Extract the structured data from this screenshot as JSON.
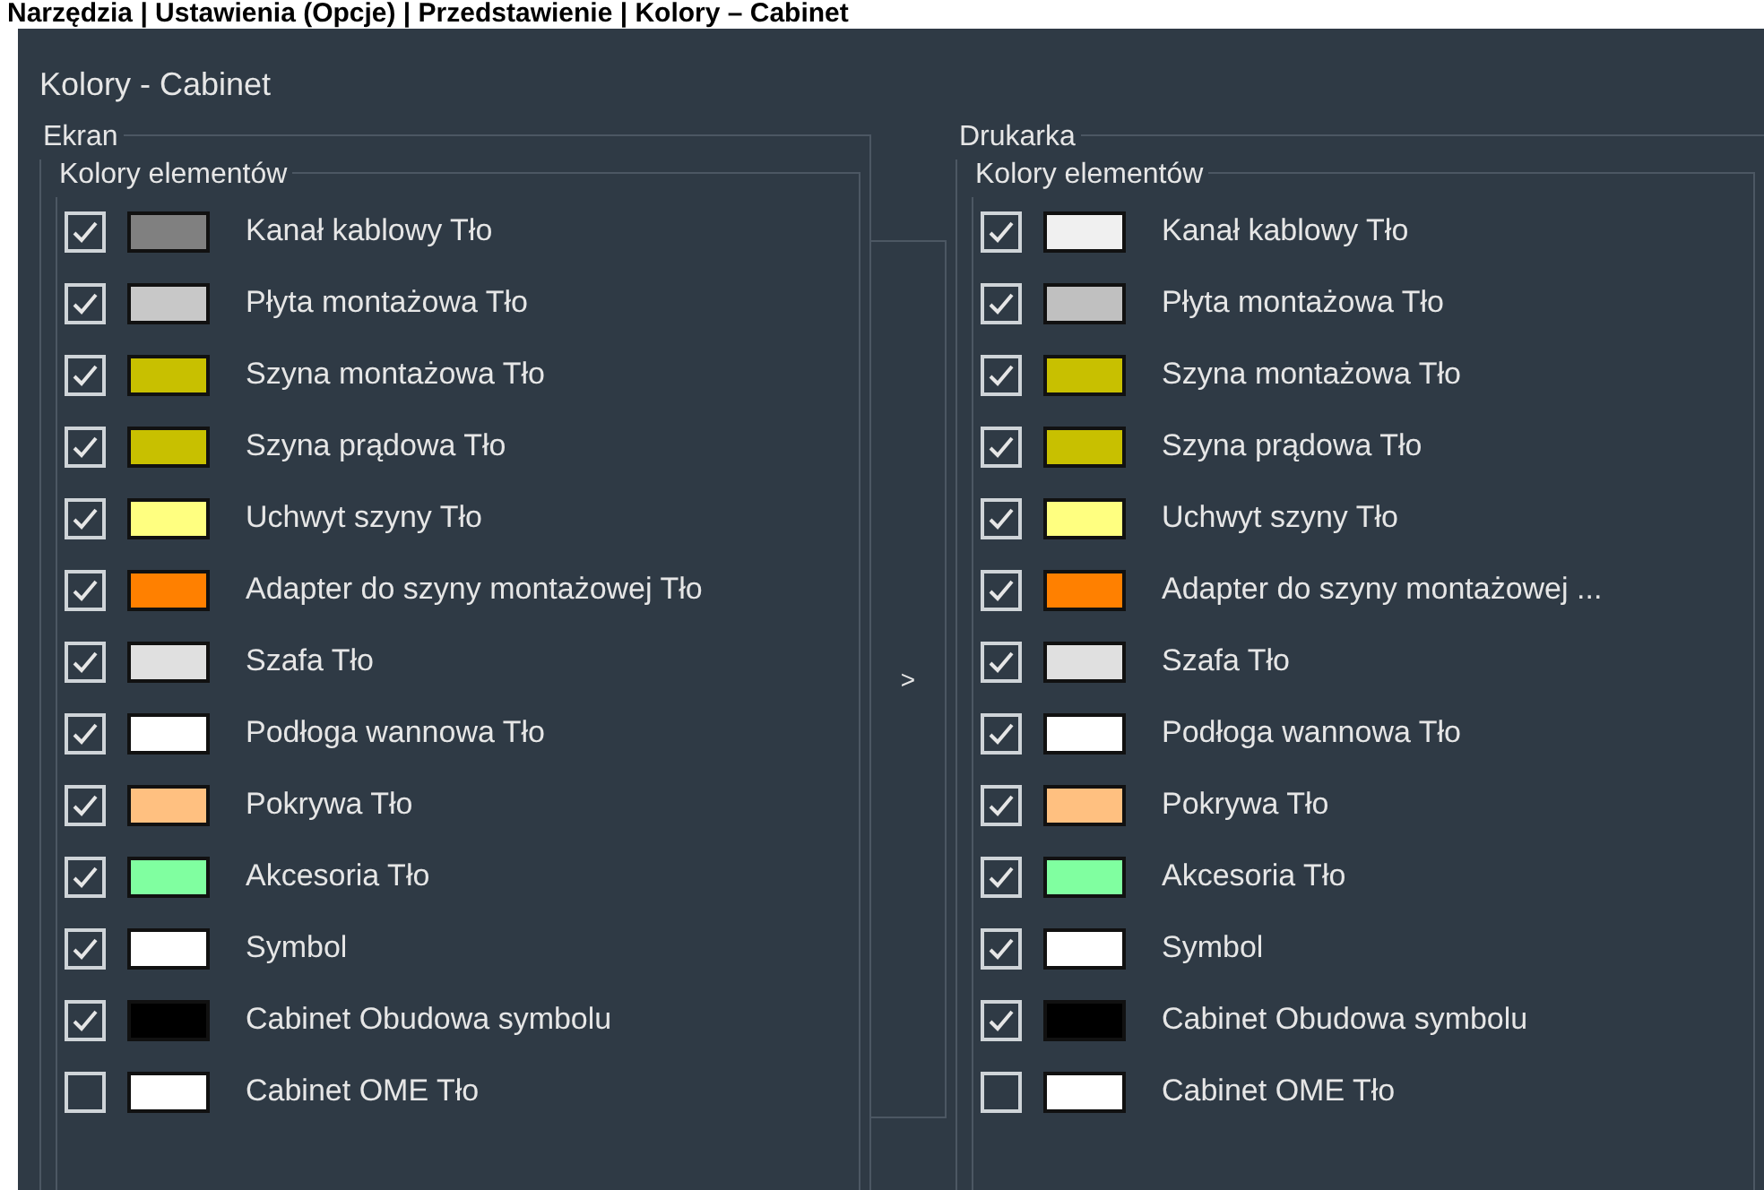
{
  "breadcrumb": "Narzędzia | Ustawienia (Opcje) | Przedstawienie | Kolory – Cabinet",
  "dialog": {
    "title": "Kolory - Cabinet",
    "panels": [
      {
        "title": "Ekran",
        "group_title": "Kolory elementów",
        "items": [
          {
            "checked": true,
            "color": "#808080",
            "label": "Kanał kablowy Tło"
          },
          {
            "checked": true,
            "color": "#c8c8c8",
            "label": "Płyta montażowa Tło"
          },
          {
            "checked": true,
            "color": "#c8c000",
            "label": "Szyna montażowa Tło"
          },
          {
            "checked": true,
            "color": "#c8c000",
            "label": "Szyna prądowa Tło"
          },
          {
            "checked": true,
            "color": "#ffff80",
            "label": "Uchwyt szyny Tło"
          },
          {
            "checked": true,
            "color": "#ff8000",
            "label": "Adapter do szyny montażowej Tło"
          },
          {
            "checked": true,
            "color": "#e0e0e0",
            "label": "Szafa Tło"
          },
          {
            "checked": true,
            "color": "#ffffff",
            "label": "Podłoga wannowa Tło"
          },
          {
            "checked": true,
            "color": "#ffc080",
            "label": "Pokrywa Tło"
          },
          {
            "checked": true,
            "color": "#80ffa0",
            "label": "Akcesoria Tło"
          },
          {
            "checked": true,
            "color": "#ffffff",
            "label": "Symbol"
          },
          {
            "checked": true,
            "color": "#000000",
            "label": "Cabinet Obudowa symbolu"
          },
          {
            "checked": false,
            "color": "#ffffff",
            "label": "Cabinet OME Tło"
          }
        ]
      },
      {
        "title": "Drukarka",
        "group_title": "Kolory elementów",
        "items": [
          {
            "checked": true,
            "color": "#f0f0f0",
            "label": "Kanał kablowy Tło"
          },
          {
            "checked": true,
            "color": "#c0c0c0",
            "label": "Płyta montażowa Tło"
          },
          {
            "checked": true,
            "color": "#c8c000",
            "label": "Szyna montażowa Tło"
          },
          {
            "checked": true,
            "color": "#c8c000",
            "label": "Szyna prądowa Tło"
          },
          {
            "checked": true,
            "color": "#ffff80",
            "label": "Uchwyt szyny Tło"
          },
          {
            "checked": true,
            "color": "#ff8000",
            "label": "Adapter do szyny montażowej ..."
          },
          {
            "checked": true,
            "color": "#e0e0e0",
            "label": "Szafa Tło"
          },
          {
            "checked": true,
            "color": "#ffffff",
            "label": "Podłoga wannowa Tło"
          },
          {
            "checked": true,
            "color": "#ffc080",
            "label": "Pokrywa Tło"
          },
          {
            "checked": true,
            "color": "#80ffa0",
            "label": "Akcesoria Tło"
          },
          {
            "checked": true,
            "color": "#ffffff",
            "label": "Symbol"
          },
          {
            "checked": true,
            "color": "#000000",
            "label": "Cabinet Obudowa symbolu"
          },
          {
            "checked": false,
            "color": "#ffffff",
            "label": "Cabinet OME Tło"
          }
        ]
      }
    ],
    "transfer_button": ">"
  }
}
